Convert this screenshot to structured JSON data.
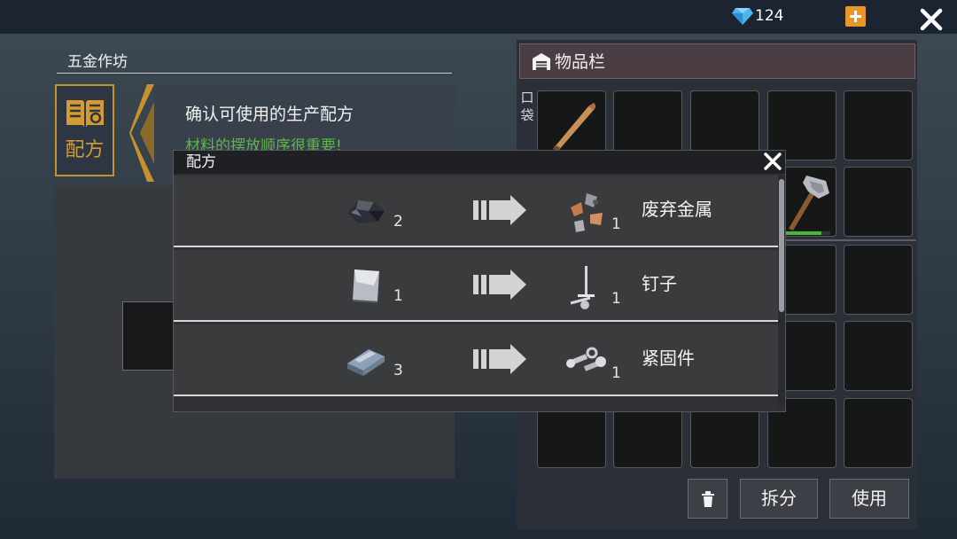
{
  "topbar": {
    "gem_count": "124",
    "gem_icon": "diamond-icon",
    "plus_icon": "plus-icon",
    "close_icon": "close-icon"
  },
  "workshop": {
    "title": "五金作坊",
    "recipe_tab_label": "配方",
    "hint_title": "确认可使用的生产配方",
    "hint_subtitle": "材料的摆放顺序很重要!"
  },
  "inventory": {
    "title": "物品栏",
    "pocket_label": "口袋",
    "items": [
      {
        "name": "baseball-bat",
        "icon": "bat-icon"
      },
      {
        "name": "stone-hammer",
        "icon": "hammer-icon",
        "durability": 0.8
      }
    ],
    "buttons": {
      "split": "拆分",
      "use": "使用"
    }
  },
  "dialog": {
    "title": "配方",
    "recipes": [
      {
        "input_icon": "ore-chunk-icon",
        "input_qty": "2",
        "output_icon": "scrap-metal-icon",
        "output_qty": "1",
        "output_name": "废弃金属"
      },
      {
        "input_icon": "metal-sheet-icon",
        "input_qty": "1",
        "output_icon": "nail-icon",
        "output_qty": "1",
        "output_name": "钉子"
      },
      {
        "input_icon": "metal-bar-icon",
        "input_qty": "3",
        "output_icon": "bolt-icon",
        "output_qty": "1",
        "output_name": "紧固件"
      }
    ]
  },
  "colors": {
    "accent_gold": "#d49b32",
    "hint_green": "#5fb54a",
    "plus_orange": "#e8962a",
    "durability_green": "#47b83c"
  }
}
